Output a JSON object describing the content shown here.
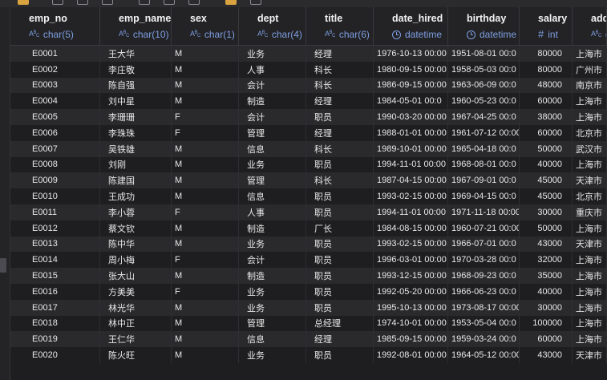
{
  "columns": [
    {
      "name": "emp_no",
      "type": "char(5)",
      "icon": "text-type-icon"
    },
    {
      "name": "emp_name",
      "type": "char(10)",
      "icon": "text-type-icon"
    },
    {
      "name": "sex",
      "type": "char(1)",
      "icon": "text-type-icon"
    },
    {
      "name": "dept",
      "type": "char(4)",
      "icon": "text-type-icon"
    },
    {
      "name": "title",
      "type": "char(6)",
      "icon": "text-type-icon"
    },
    {
      "name": "date_hired",
      "type": "datetime",
      "icon": "clock-icon"
    },
    {
      "name": "birthday",
      "type": "datetime",
      "icon": "clock-icon"
    },
    {
      "name": "salary",
      "type": "int",
      "icon": "hash-icon"
    },
    {
      "name": "addr",
      "type": "char",
      "icon": "text-type-icon"
    }
  ],
  "rows": [
    [
      "E0001",
      "王大华",
      "M",
      "业务",
      "经理",
      "1976-10-13 00:00",
      "1951-08-01 00:0",
      "80000",
      "上海市"
    ],
    [
      "E0002",
      "李庄敬",
      "M",
      "人事",
      "科长",
      "1980-09-15 00:00",
      "1958-05-03 00:0",
      "80000",
      "广州市"
    ],
    [
      "E0003",
      "陈自强",
      "M",
      "会计",
      "科长",
      "1986-09-15 00:00",
      "1963-06-09 00:0",
      "48000",
      "南京市"
    ],
    [
      "E0004",
      "刘中星",
      "M",
      "制造",
      "经理",
      "1984-05-01 00:0",
      "1960-05-23 00:0",
      "60000",
      "上海市"
    ],
    [
      "E0005",
      "李珊珊",
      "F",
      "会计",
      "职员",
      "1990-03-20 00:00",
      "1967-04-25 00:0",
      "38000",
      "上海市"
    ],
    [
      "E0006",
      "李珠珠",
      "F",
      "管理",
      "经理",
      "1988-01-01 00:00",
      "1961-07-12 00:00",
      "60000",
      "北京市"
    ],
    [
      "E0007",
      "吴铁雄",
      "M",
      "信息",
      "科长",
      "1989-10-01 00:00",
      "1965-04-18 00:0",
      "50000",
      "武汉市"
    ],
    [
      "E0008",
      "刘刚",
      "M",
      "业务",
      "职员",
      "1994-11-01 00:00",
      "1968-08-01 00:0",
      "40000",
      "上海市"
    ],
    [
      "E0009",
      "陈建国",
      "M",
      "管理",
      "科长",
      "1987-04-15 00:00",
      "1967-09-01 00:0",
      "45000",
      "天津市"
    ],
    [
      "E0010",
      "王成功",
      "M",
      "信息",
      "职员",
      "1993-02-15 00:00",
      "1969-04-15 00:0",
      "45000",
      "北京市"
    ],
    [
      "E0011",
      "李小蓉",
      "F",
      "人事",
      "职员",
      "1994-11-01 00:00",
      "1971-11-18 00:00",
      "30000",
      "重庆市"
    ],
    [
      "E0012",
      "蔡文钦",
      "M",
      "制造",
      "厂长",
      "1984-08-15 00:00",
      "1960-07-21 00:00",
      "50000",
      "上海市"
    ],
    [
      "E0013",
      "陈中华",
      "M",
      "业务",
      "职员",
      "1993-02-15 00:00",
      "1966-07-01 00:0",
      "43000",
      "天津市"
    ],
    [
      "E0014",
      "周小梅",
      "F",
      "会计",
      "职员",
      "1996-03-01 00:00",
      "1970-03-28 00:0",
      "32000",
      "上海市"
    ],
    [
      "E0015",
      "张大山",
      "M",
      "制造",
      "职员",
      "1993-12-15 00:00",
      "1968-09-23 00:0",
      "35000",
      "上海市"
    ],
    [
      "E0016",
      "方美美",
      "F",
      "业务",
      "职员",
      "1992-05-20 00:00",
      "1966-06-23 00:0",
      "40000",
      "上海市"
    ],
    [
      "E0017",
      "林光华",
      "M",
      "业务",
      "职员",
      "1995-10-13 00:00",
      "1973-08-17 00:00",
      "30000",
      "上海市"
    ],
    [
      "E0018",
      "林中正",
      "M",
      "管理",
      "总经理",
      "1974-10-01 00:00",
      "1953-05-04 00:0",
      "100000",
      "上海市"
    ],
    [
      "E0019",
      "王仁华",
      "M",
      "信息",
      "经理",
      "1985-09-15 00:00",
      "1959-03-24 00:0",
      "60000",
      "上海市"
    ],
    [
      "E0020",
      "陈火旺",
      "M",
      "业务",
      "职员",
      "1992-08-01 00:00",
      "1964-05-12 00:00",
      "43000",
      "天津市"
    ]
  ],
  "colors": {
    "background": "#1e1e20",
    "row_alt": "#2a2a2d",
    "header": "#232326",
    "type_text": "#7e9ee0"
  }
}
